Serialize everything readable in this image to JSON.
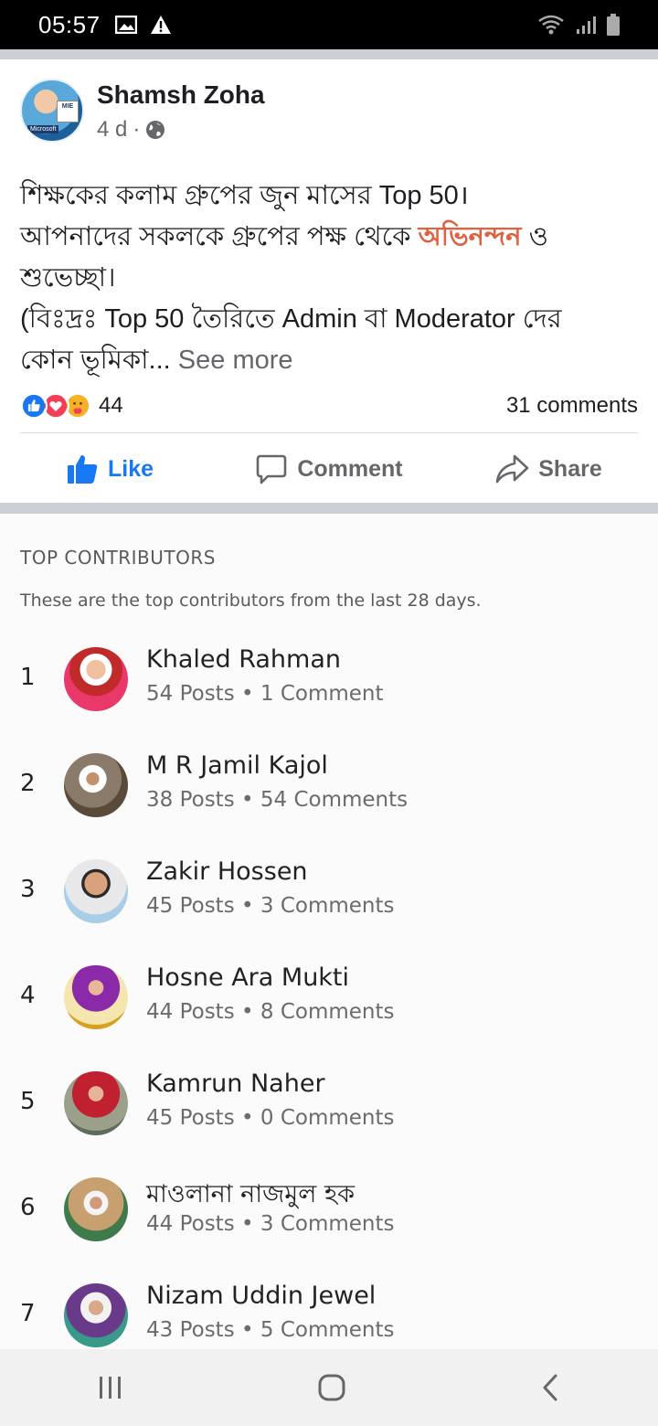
{
  "status_bar": {
    "time": "05:57",
    "left_icons": [
      "image-icon",
      "warning-icon"
    ],
    "right_icons": [
      "wifi-icon",
      "signal-icon",
      "battery-icon"
    ]
  },
  "post": {
    "author": "Shamsh Zoha",
    "time": "4 d",
    "privacy_icon": "globe-icon",
    "avatar_text": {
      "tag": "Microsoft",
      "badge": "MIE"
    },
    "text": {
      "line1": "শিক্ষকের কলাম গ্রুপের জুন মাসের Top 50।",
      "line2_before": "আপনাদের সকলকে গ্রুপের পক্ষ থেকে ",
      "line2_highlight": "অভিনন্দন",
      "line2_after": " ও",
      "line3": "শুভেচ্ছা।",
      "line4": "(বিঃদ্রঃ Top 50 তৈরিতে Admin বা Moderator দের",
      "line5": "কোন ভূমিকা...",
      "see_more": "See more"
    },
    "reactions": {
      "icons": [
        "like-reaction-icon",
        "love-reaction-icon",
        "care-reaction-icon"
      ],
      "count": "44",
      "comments": "31 comments"
    },
    "actions": {
      "like": "Like",
      "comment": "Comment",
      "share": "Share"
    }
  },
  "contributors": {
    "title": "TOP CONTRIBUTORS",
    "subtitle": "These are the top contributors from the last 28 days.",
    "items": [
      {
        "rank": "1",
        "name": "Khaled Rahman",
        "stats": "54 Posts • 1 Comment"
      },
      {
        "rank": "2",
        "name": "M R Jamil Kajol",
        "stats": "38 Posts • 54 Comments"
      },
      {
        "rank": "3",
        "name": "Zakir Hossen",
        "stats": "45 Posts • 3 Comments"
      },
      {
        "rank": "4",
        "name": "Hosne Ara Mukti",
        "stats": "44 Posts • 8 Comments"
      },
      {
        "rank": "5",
        "name": "Kamrun Naher",
        "stats": "45 Posts • 0 Comments"
      },
      {
        "rank": "6",
        "name": "মাওলানা নাজমুল হক",
        "stats": "44 Posts • 3 Comments"
      },
      {
        "rank": "7",
        "name": "Nizam Uddin Jewel",
        "stats": "43 Posts • 5 Comments"
      }
    ]
  },
  "nav_bar": {
    "icons": [
      "recent-apps-icon",
      "home-icon",
      "back-icon"
    ]
  },
  "colors": {
    "link_blue": "#1877f2",
    "highlight_orange": "#e0613f",
    "secondary_text": "#65676b"
  }
}
